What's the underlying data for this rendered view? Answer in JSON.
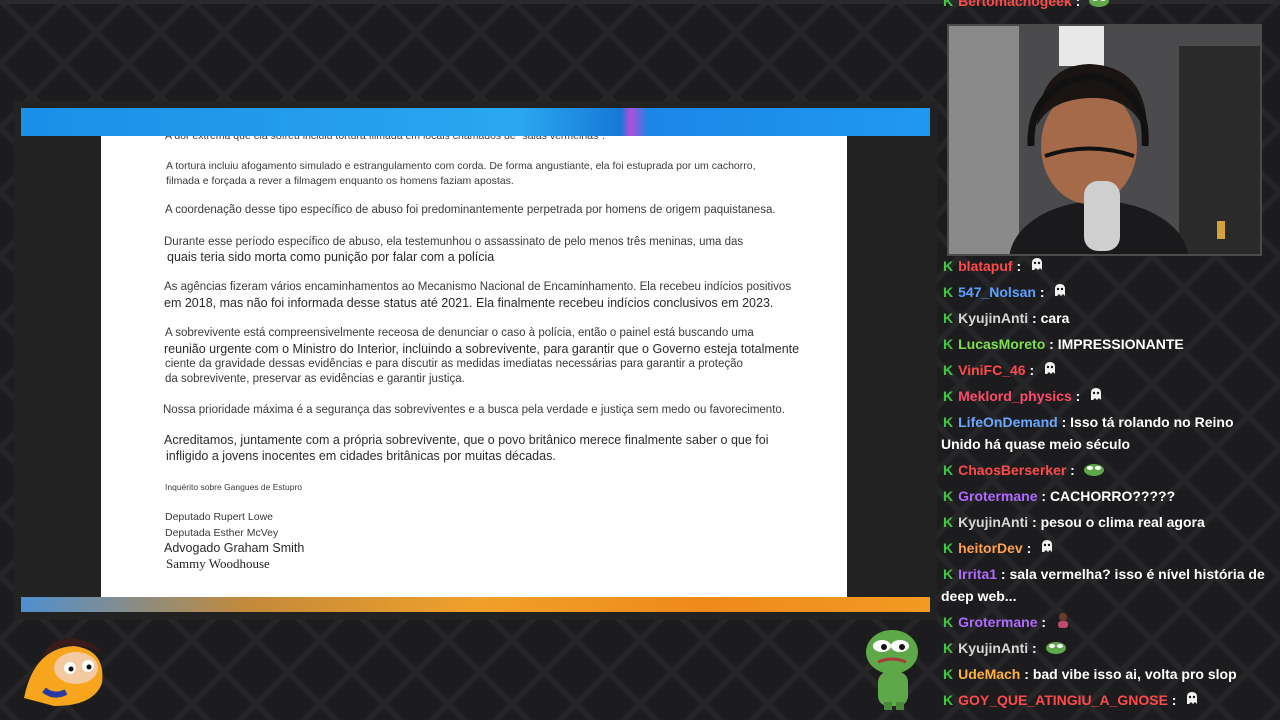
{
  "document": {
    "lines": [
      {
        "text": "A dor extrema que ela sofreu incluiu tortura filmada em locais chamados de \"salas vermelhas\".",
        "size": "s"
      },
      {
        "text": "A tortura incluiu afogamento simulado e estrangulamento com corda. De forma angustiante, ela foi estuprada por um cachorro,",
        "size": "s"
      },
      {
        "text": "filmada e forçada a rever a filmagem enquanto os homens faziam apostas.",
        "size": "s"
      },
      {
        "text": "A coordenação desse tipo específico de abuso foi predominantemente perpetrada por homens de origem paquistanesa.",
        "size": "m"
      },
      {
        "text": "Durante esse período específico de abuso, ela testemunhou o assassinato de pelo menos três meninas, uma das",
        "size": "m"
      },
      {
        "text": "quais teria sido morta como punição por falar com a polícia",
        "size": "l"
      },
      {
        "text": "As agências fizeram vários encaminhamentos ao Mecanismo Nacional de Encaminhamento. Ela recebeu indícios positivos",
        "size": "m"
      },
      {
        "text": "em 2018, mas não foi informada desse status até 2021. Ela finalmente recebeu indícios conclusivos em 2023.",
        "size": "l"
      },
      {
        "text": "A sobrevivente está compreensivelmente receosa de denunciar o caso à polícia, então o painel está buscando uma",
        "size": "m"
      },
      {
        "text": "reunião urgente com o Ministro do Interior, incluindo a sobrevivente, para garantir que o Governo esteja totalmente",
        "size": "l"
      },
      {
        "text": "ciente da gravidade dessas evidências e para discutir as medidas imediatas necessárias para garantir a proteção",
        "size": "m"
      },
      {
        "text": "da sobrevivente, preservar as evidências e garantir justiça.",
        "size": "m"
      },
      {
        "text": "Nossa prioridade máxima é a segurança das sobreviventes e a busca pela verdade e justiça sem medo ou favorecimento.",
        "size": "m"
      },
      {
        "text": "Acreditamos, juntamente com a própria sobrevivente, que o povo britânico merece finalmente saber o que foi",
        "size": "l"
      },
      {
        "text": "infligido a jovens inocentes em cidades britânicas por muitas décadas.",
        "size": "l"
      },
      {
        "text": "Inquérito sobre Gangues de Estupro",
        "size": "xs"
      },
      {
        "text": "Deputado Rupert Lowe",
        "size": "s"
      },
      {
        "text": "Deputada Esther McVey",
        "size": "s"
      },
      {
        "text": "Advogado Graham Smith",
        "size": "l"
      },
      {
        "text": "Sammy Woodhouse",
        "size": "sig"
      }
    ]
  },
  "chat": {
    "messages": [
      {
        "user": "Bertomachogeek",
        "color": "#ff4a4a",
        "text": "",
        "emote": "frog"
      },
      {
        "user": "blatapuf",
        "color": "#ff4a4a",
        "text": "",
        "emote": "ghost"
      },
      {
        "user": "547_Nolsan",
        "color": "#5aa0ff",
        "text": "",
        "emote": "ghost"
      },
      {
        "user": "KyujinAnti",
        "color": "#d6d6d6",
        "text": "cara",
        "emote": ""
      },
      {
        "user": "LucasMoreto",
        "color": "#7ee04a",
        "text": "IMPRESSIONANTE",
        "emote": ""
      },
      {
        "user": "ViniFC_46",
        "color": "#ff4a4a",
        "text": "",
        "emote": "ghost"
      },
      {
        "user": "Meklord_physics",
        "color": "#ff4a6a",
        "text": "",
        "emote": "ghost"
      },
      {
        "user": "LifeOnDemand",
        "color": "#6aa8ff",
        "text": "Isso tá rolando no Reino Unido há quase meio século",
        "emote": ""
      },
      {
        "user": "ChaosBerserker",
        "color": "#ff4a4a",
        "text": "",
        "emote": "frog"
      },
      {
        "user": "Grotermane",
        "color": "#b06aff",
        "text": "CACHORRO?????",
        "emote": ""
      },
      {
        "user": "KyujinAnti",
        "color": "#d6d6d6",
        "text": "pesou o clima real agora",
        "emote": ""
      },
      {
        "user": "heitorDev",
        "color": "#ffa050",
        "text": "",
        "emote": "ghost"
      },
      {
        "user": "Irrita1",
        "color": "#b06aff",
        "text": "sala vermelha? isso é nível história de deep web...",
        "emote": ""
      },
      {
        "user": "Grotermane",
        "color": "#b06aff",
        "text": "",
        "emote": "person"
      },
      {
        "user": "KyujinAnti",
        "color": "#d6d6d6",
        "text": "",
        "emote": "frog"
      },
      {
        "user": "UdeMach",
        "color": "#ffb23a",
        "text": "bad vibe isso ai, volta pro slop",
        "emote": ""
      },
      {
        "user": "GOY_QUE_ATINGIU_A_GNOSE",
        "color": "#ff4a4a",
        "text": "",
        "emote": "ghost"
      }
    ]
  }
}
